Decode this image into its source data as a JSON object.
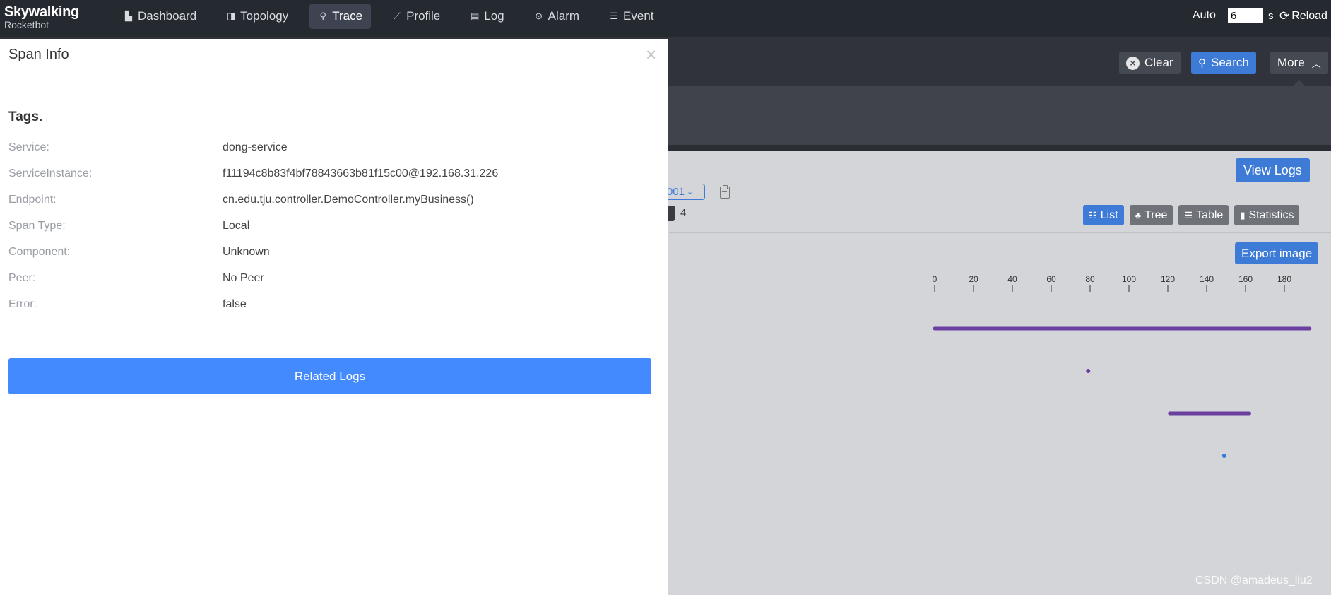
{
  "app": {
    "brand": "Skywalking",
    "sub": "Rocketbot"
  },
  "nav": {
    "items": [
      {
        "label": "Dashboard",
        "icon": "bar-chart-icon",
        "glyph": "▙"
      },
      {
        "label": "Topology",
        "icon": "topology-icon",
        "glyph": "◨"
      },
      {
        "label": "Trace",
        "icon": "trace-icon",
        "glyph": "⚲",
        "active": true
      },
      {
        "label": "Profile",
        "icon": "profile-icon",
        "glyph": "⟋"
      },
      {
        "label": "Log",
        "icon": "log-icon",
        "glyph": "▤"
      },
      {
        "label": "Alarm",
        "icon": "alarm-icon",
        "glyph": "⊙"
      },
      {
        "label": "Event",
        "icon": "event-icon",
        "glyph": "☰"
      }
    ]
  },
  "header": {
    "auto_label": "Auto",
    "auto_value": "6",
    "auto_unit": "s",
    "reload_label": "Reload"
  },
  "toolbar": {
    "clear_label": "Clear",
    "search_label": "Search",
    "more_label": "More"
  },
  "trace": {
    "view_logs_label": "View Logs",
    "trace_id_fragment": "001",
    "span_count": "4",
    "tabs": [
      {
        "label": "List",
        "icon": "list-icon",
        "glyph": "☷",
        "active": true
      },
      {
        "label": "Tree",
        "icon": "tree-icon",
        "glyph": "♣"
      },
      {
        "label": "Table",
        "icon": "table-icon",
        "glyph": "☰"
      },
      {
        "label": "Statistics",
        "icon": "statistics-icon",
        "glyph": "▮"
      }
    ],
    "export_label": "Export image"
  },
  "chart_data": {
    "type": "gantt",
    "ticks": [
      0,
      20,
      40,
      60,
      80,
      100,
      120,
      140,
      160,
      180
    ],
    "spans": [
      {
        "start": 0,
        "end": 193,
        "color": "#6a3fa0"
      },
      {
        "start": 79,
        "end": 79,
        "color": "#6a3fa0"
      },
      {
        "start": 121,
        "end": 162,
        "color": "#6a3fa0"
      },
      {
        "start": 149,
        "end": 149,
        "color": "#2f7ed8"
      }
    ]
  },
  "panel": {
    "title": "Span Info",
    "close_glyph": "×",
    "tags_title": "Tags.",
    "tags": [
      {
        "key": "Service:",
        "value": "dong-service"
      },
      {
        "key": "ServiceInstance:",
        "value": "f11194c8b83f4bf78843663b81f15c00@192.168.31.226"
      },
      {
        "key": "Endpoint:",
        "value": "cn.edu.tju.controller.DemoController.myBusiness()"
      },
      {
        "key": "Span Type:",
        "value": "Local"
      },
      {
        "key": "Component:",
        "value": "Unknown"
      },
      {
        "key": "Peer:",
        "value": "No Peer"
      },
      {
        "key": "Error:",
        "value": "false"
      }
    ],
    "related_logs_label": "Related Logs"
  },
  "watermark": "CSDN @amadeus_liu2"
}
